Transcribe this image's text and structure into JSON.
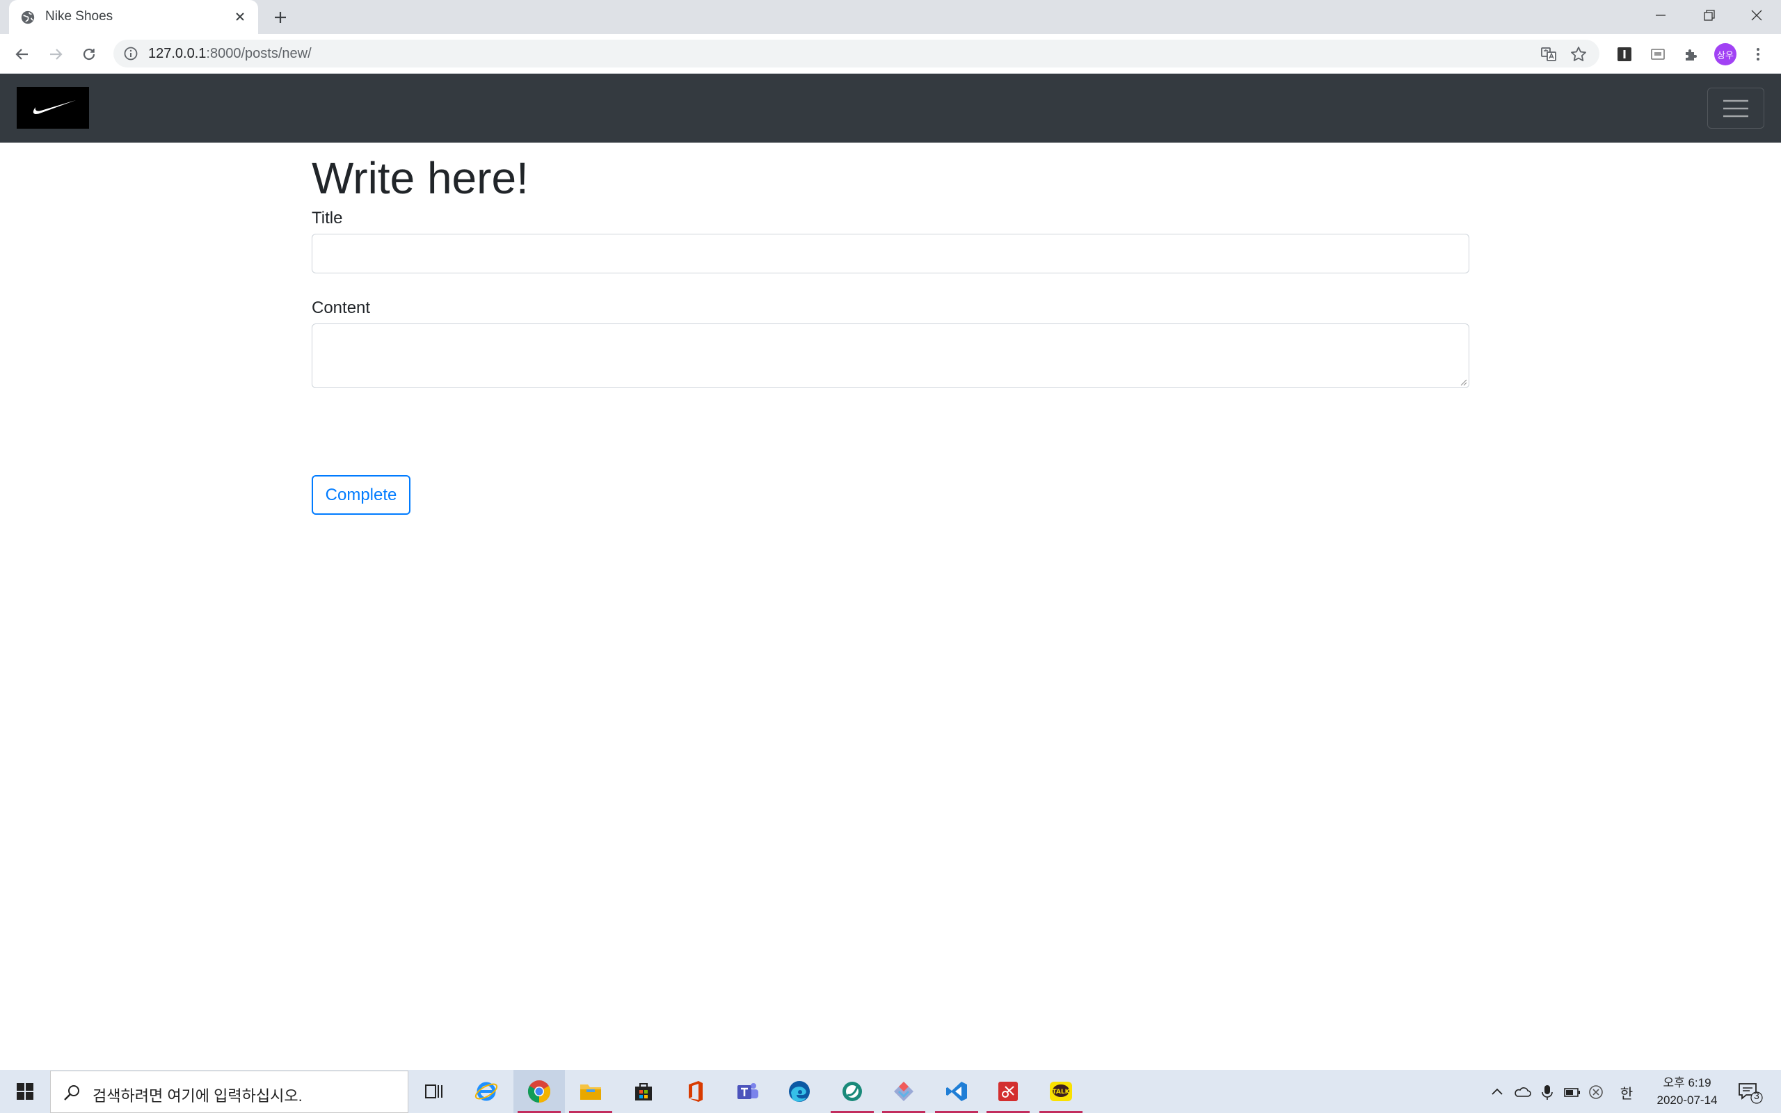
{
  "browser": {
    "tab_title": "Nike Shoes",
    "url_host": "127.0.0.1",
    "url_rest": ":8000/posts/new/",
    "profile_initials": "상우"
  },
  "page": {
    "heading": "Write here!",
    "title_label": "Title",
    "title_value": "",
    "content_label": "Content",
    "content_value": "",
    "submit_label": "Complete"
  },
  "taskbar": {
    "search_placeholder": "검색하려면 여기에 입력하십시오.",
    "ime_indicator": "한",
    "time": "오후 6:19",
    "date": "2020-07-14",
    "notification_count": "3",
    "apps": [
      "task-view",
      "internet-explorer",
      "chrome",
      "file-explorer",
      "microsoft-store",
      "office",
      "teams",
      "edge",
      "app-green",
      "sourcetree",
      "vscode",
      "app-red",
      "kakaotalk"
    ]
  },
  "colors": {
    "navbar": "#343a40",
    "accent": "#007bff"
  }
}
